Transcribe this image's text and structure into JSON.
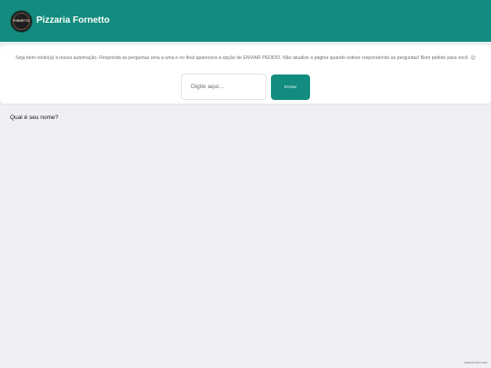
{
  "header": {
    "title": "Pizzaria Fornetto",
    "logo_text": "FORNETTO",
    "background_color": "#128c7e"
  },
  "intro": {
    "welcome_text": "Seja bem-vindo(a) à nossa automação. Responda as perguntas uma a uma e no final aparecerá a opção de ENVIAR PEDIDO. Não atualize a página quando estiver respondendo as perguntas! Bom pedido para você. 😉",
    "input_placeholder": "Digite aqui...",
    "input_value": "",
    "send_label": "Enviar"
  },
  "chat": {
    "question": "Qual é seu nome?"
  },
  "footer": {
    "credit": "Criado por Nome Autor"
  },
  "colors": {
    "accent": "#128c7e",
    "page_background": "#eff0f3"
  }
}
